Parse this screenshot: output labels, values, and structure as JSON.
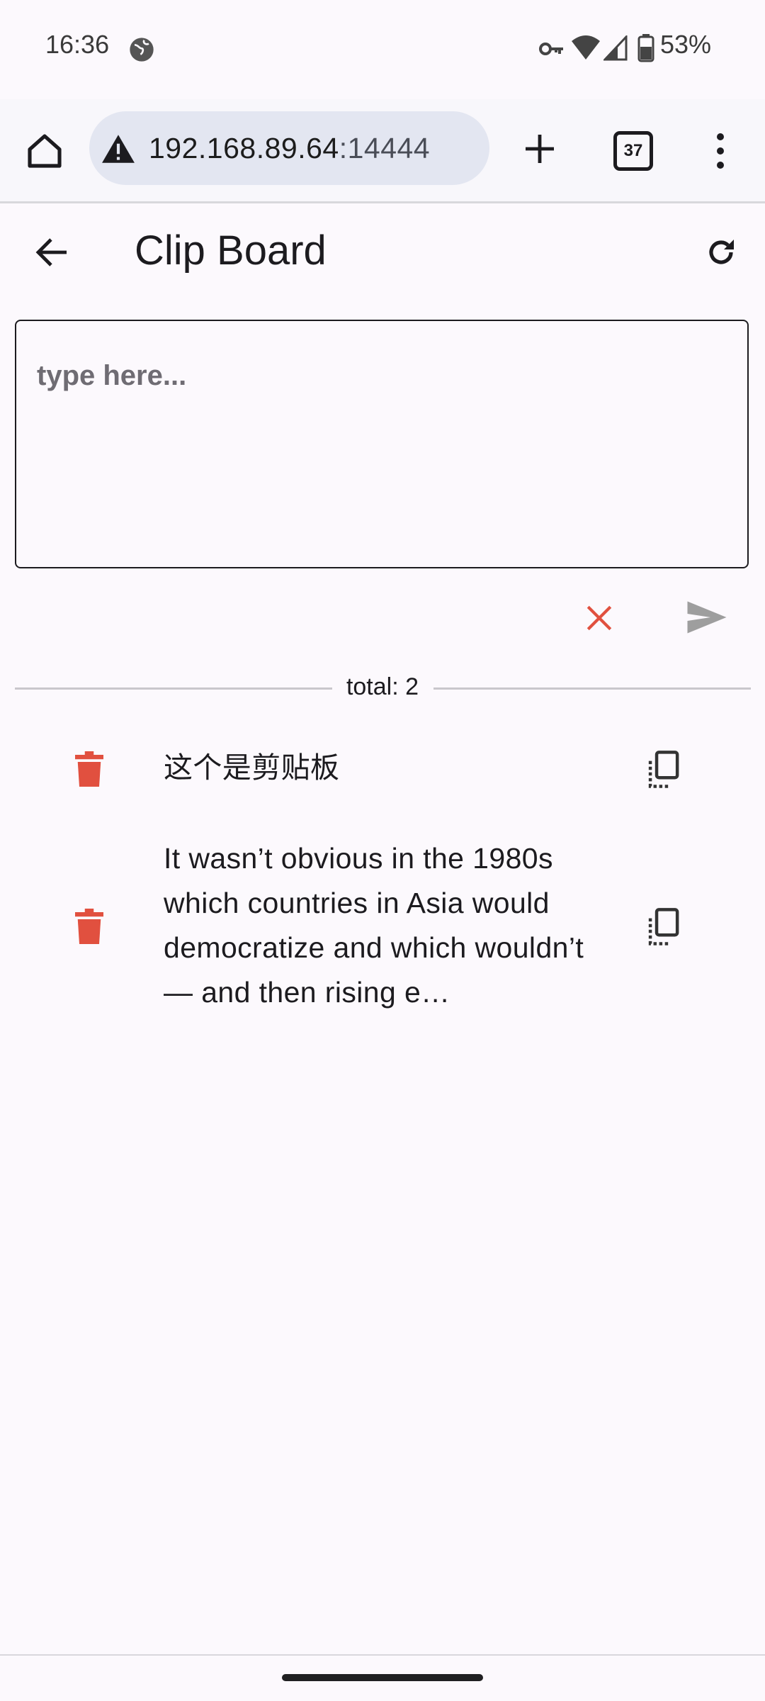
{
  "status_bar": {
    "time": "16:36",
    "battery": "53%"
  },
  "browser": {
    "url_host": "192.168.89.64",
    "url_port": ":14444",
    "tab_count": "37"
  },
  "app_bar": {
    "title": "Clip Board"
  },
  "input": {
    "placeholder": "type here..."
  },
  "list": {
    "total_label": "total: 2",
    "items": [
      {
        "text": "这个是剪贴板"
      },
      {
        "text": "It wasn’t obvious in the 1980s which countries in Asia would democratize and which wouldn’t — and then rising e…"
      }
    ]
  },
  "colors": {
    "danger": "#e1503f",
    "send_disabled": "#9e9e9e",
    "background": "#fcf9fd"
  },
  "icons": [
    "globe-icon",
    "key-icon",
    "wifi-icon",
    "signal-icon",
    "battery-icon",
    "home-icon",
    "warning-icon",
    "plus-icon",
    "tabs-icon",
    "more-icon",
    "back-arrow-icon",
    "refresh-icon",
    "close-icon",
    "send-icon",
    "trash-icon",
    "copy-icon"
  ]
}
